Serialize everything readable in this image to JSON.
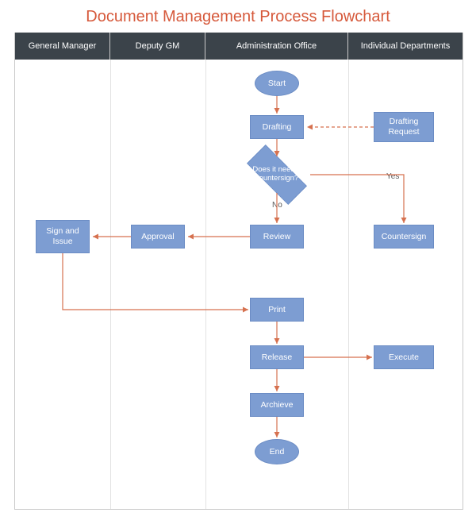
{
  "title": "Document Management Process Flowchart",
  "lanes": {
    "l1": "General Manager",
    "l2": "Deputy GM",
    "l3": "Administration Office",
    "l4": "Individual Departments"
  },
  "nodes": {
    "start": "Start",
    "drafting": "Drafting",
    "drafting_request": "Drafting Request",
    "decision": "Does it need a countersign?",
    "review": "Review",
    "countersign": "Countersign",
    "approval": "Approval",
    "sign_issue": "Sign and Issue",
    "print": "Print",
    "release": "Release",
    "execute": "Execute",
    "archive": "Archieve",
    "end": "End"
  },
  "edges": {
    "yes": "Yes",
    "no": "No"
  },
  "chart_data": {
    "type": "flowchart-swimlane",
    "title": "Document Management Process Flowchart",
    "lanes": [
      "General Manager",
      "Deputy GM",
      "Administration Office",
      "Individual Departments"
    ],
    "nodes": [
      {
        "id": "start",
        "label": "Start",
        "shape": "ellipse",
        "lane": "Administration Office"
      },
      {
        "id": "drafting",
        "label": "Drafting",
        "shape": "rect",
        "lane": "Administration Office"
      },
      {
        "id": "drafting_request",
        "label": "Drafting Request",
        "shape": "rect",
        "lane": "Individual Departments"
      },
      {
        "id": "decision",
        "label": "Does it need a countersign?",
        "shape": "diamond",
        "lane": "Administration Office"
      },
      {
        "id": "review",
        "label": "Review",
        "shape": "rect",
        "lane": "Administration Office"
      },
      {
        "id": "countersign",
        "label": "Countersign",
        "shape": "rect",
        "lane": "Individual Departments"
      },
      {
        "id": "approval",
        "label": "Approval",
        "shape": "rect",
        "lane": "Deputy GM"
      },
      {
        "id": "sign_issue",
        "label": "Sign and Issue",
        "shape": "rect",
        "lane": "General Manager"
      },
      {
        "id": "print",
        "label": "Print",
        "shape": "rect",
        "lane": "Administration Office"
      },
      {
        "id": "release",
        "label": "Release",
        "shape": "rect",
        "lane": "Administration Office"
      },
      {
        "id": "execute",
        "label": "Execute",
        "shape": "rect",
        "lane": "Individual Departments"
      },
      {
        "id": "archive",
        "label": "Archieve",
        "shape": "rect",
        "lane": "Administration Office"
      },
      {
        "id": "end",
        "label": "End",
        "shape": "ellipse",
        "lane": "Administration Office"
      }
    ],
    "edges": [
      {
        "from": "start",
        "to": "drafting"
      },
      {
        "from": "drafting_request",
        "to": "drafting",
        "style": "dashed"
      },
      {
        "from": "drafting",
        "to": "decision"
      },
      {
        "from": "decision",
        "to": "review",
        "label": "No"
      },
      {
        "from": "decision",
        "to": "countersign",
        "label": "Yes"
      },
      {
        "from": "review",
        "to": "approval"
      },
      {
        "from": "approval",
        "to": "sign_issue"
      },
      {
        "from": "sign_issue",
        "to": "print"
      },
      {
        "from": "print",
        "to": "release"
      },
      {
        "from": "release",
        "to": "execute"
      },
      {
        "from": "release",
        "to": "archive"
      },
      {
        "from": "archive",
        "to": "end"
      }
    ]
  },
  "colors": {
    "title": "#d6593b",
    "lane_header_bg": "#3b434a",
    "node_fill": "#7d9dd2",
    "arrow": "#d6714f"
  }
}
